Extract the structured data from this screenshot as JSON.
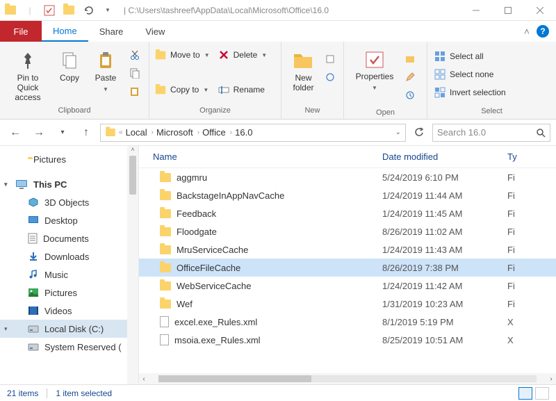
{
  "title_path": "| C:\\Users\\tashreef\\AppData\\Local\\Microsoft\\Office\\16.0",
  "tabs": {
    "file": "File",
    "home": "Home",
    "share": "Share",
    "view": "View"
  },
  "ribbon": {
    "clipboard": {
      "pin": "Pin to Quick access",
      "copy": "Copy",
      "paste": "Paste",
      "label": "Clipboard"
    },
    "organize": {
      "moveto": "Move to",
      "copyto": "Copy to",
      "delete": "Delete",
      "rename": "Rename",
      "label": "Organize"
    },
    "new": {
      "newfolder": "New folder",
      "label": "New"
    },
    "open": {
      "properties": "Properties",
      "label": "Open"
    },
    "select": {
      "all": "Select all",
      "none": "Select none",
      "invert": "Invert selection",
      "label": "Select"
    }
  },
  "breadcrumb": [
    "Local",
    "Microsoft",
    "Office",
    "16.0"
  ],
  "search_placeholder": "Search 16.0",
  "tree": [
    {
      "label": "Pictures",
      "kind": "folder",
      "indent": 1
    },
    {
      "label": "This PC",
      "kind": "pc",
      "indent": 0,
      "expand": true,
      "bold": true
    },
    {
      "label": "3D Objects",
      "kind": "3d",
      "indent": 1
    },
    {
      "label": "Desktop",
      "kind": "desktop",
      "indent": 1
    },
    {
      "label": "Documents",
      "kind": "docs",
      "indent": 1
    },
    {
      "label": "Downloads",
      "kind": "down",
      "indent": 1
    },
    {
      "label": "Music",
      "kind": "music",
      "indent": 1
    },
    {
      "label": "Pictures",
      "kind": "pics",
      "indent": 1
    },
    {
      "label": "Videos",
      "kind": "video",
      "indent": 1
    },
    {
      "label": "Local Disk (C:)",
      "kind": "disk",
      "indent": 1,
      "selected": true,
      "expand": true
    },
    {
      "label": "System Reserved (",
      "kind": "disk",
      "indent": 1
    }
  ],
  "columns": {
    "name": "Name",
    "date": "Date modified",
    "type": "Ty"
  },
  "rows": [
    {
      "name": "aggmru",
      "date": "5/24/2019 6:10 PM",
      "type": "Fi",
      "kind": "folder"
    },
    {
      "name": "BackstageInAppNavCache",
      "date": "1/24/2019 11:44 AM",
      "type": "Fi",
      "kind": "folder"
    },
    {
      "name": "Feedback",
      "date": "1/24/2019 11:45 AM",
      "type": "Fi",
      "kind": "folder"
    },
    {
      "name": "Floodgate",
      "date": "8/26/2019 11:02 AM",
      "type": "Fi",
      "kind": "folder"
    },
    {
      "name": "MruServiceCache",
      "date": "1/24/2019 11:43 AM",
      "type": "Fi",
      "kind": "folder"
    },
    {
      "name": "OfficeFileCache",
      "date": "8/26/2019 7:38 PM",
      "type": "Fi",
      "kind": "folder",
      "selected": true
    },
    {
      "name": "WebServiceCache",
      "date": "1/24/2019 11:42 AM",
      "type": "Fi",
      "kind": "folder"
    },
    {
      "name": "Wef",
      "date": "1/31/2019 10:23 AM",
      "type": "Fi",
      "kind": "folder"
    },
    {
      "name": "excel.exe_Rules.xml",
      "date": "8/1/2019 5:19 PM",
      "type": "X",
      "kind": "file"
    },
    {
      "name": "msoia.exe_Rules.xml",
      "date": "8/25/2019 10:51 AM",
      "type": "X",
      "kind": "file"
    }
  ],
  "status": {
    "count": "21 items",
    "selected": "1 item selected"
  }
}
